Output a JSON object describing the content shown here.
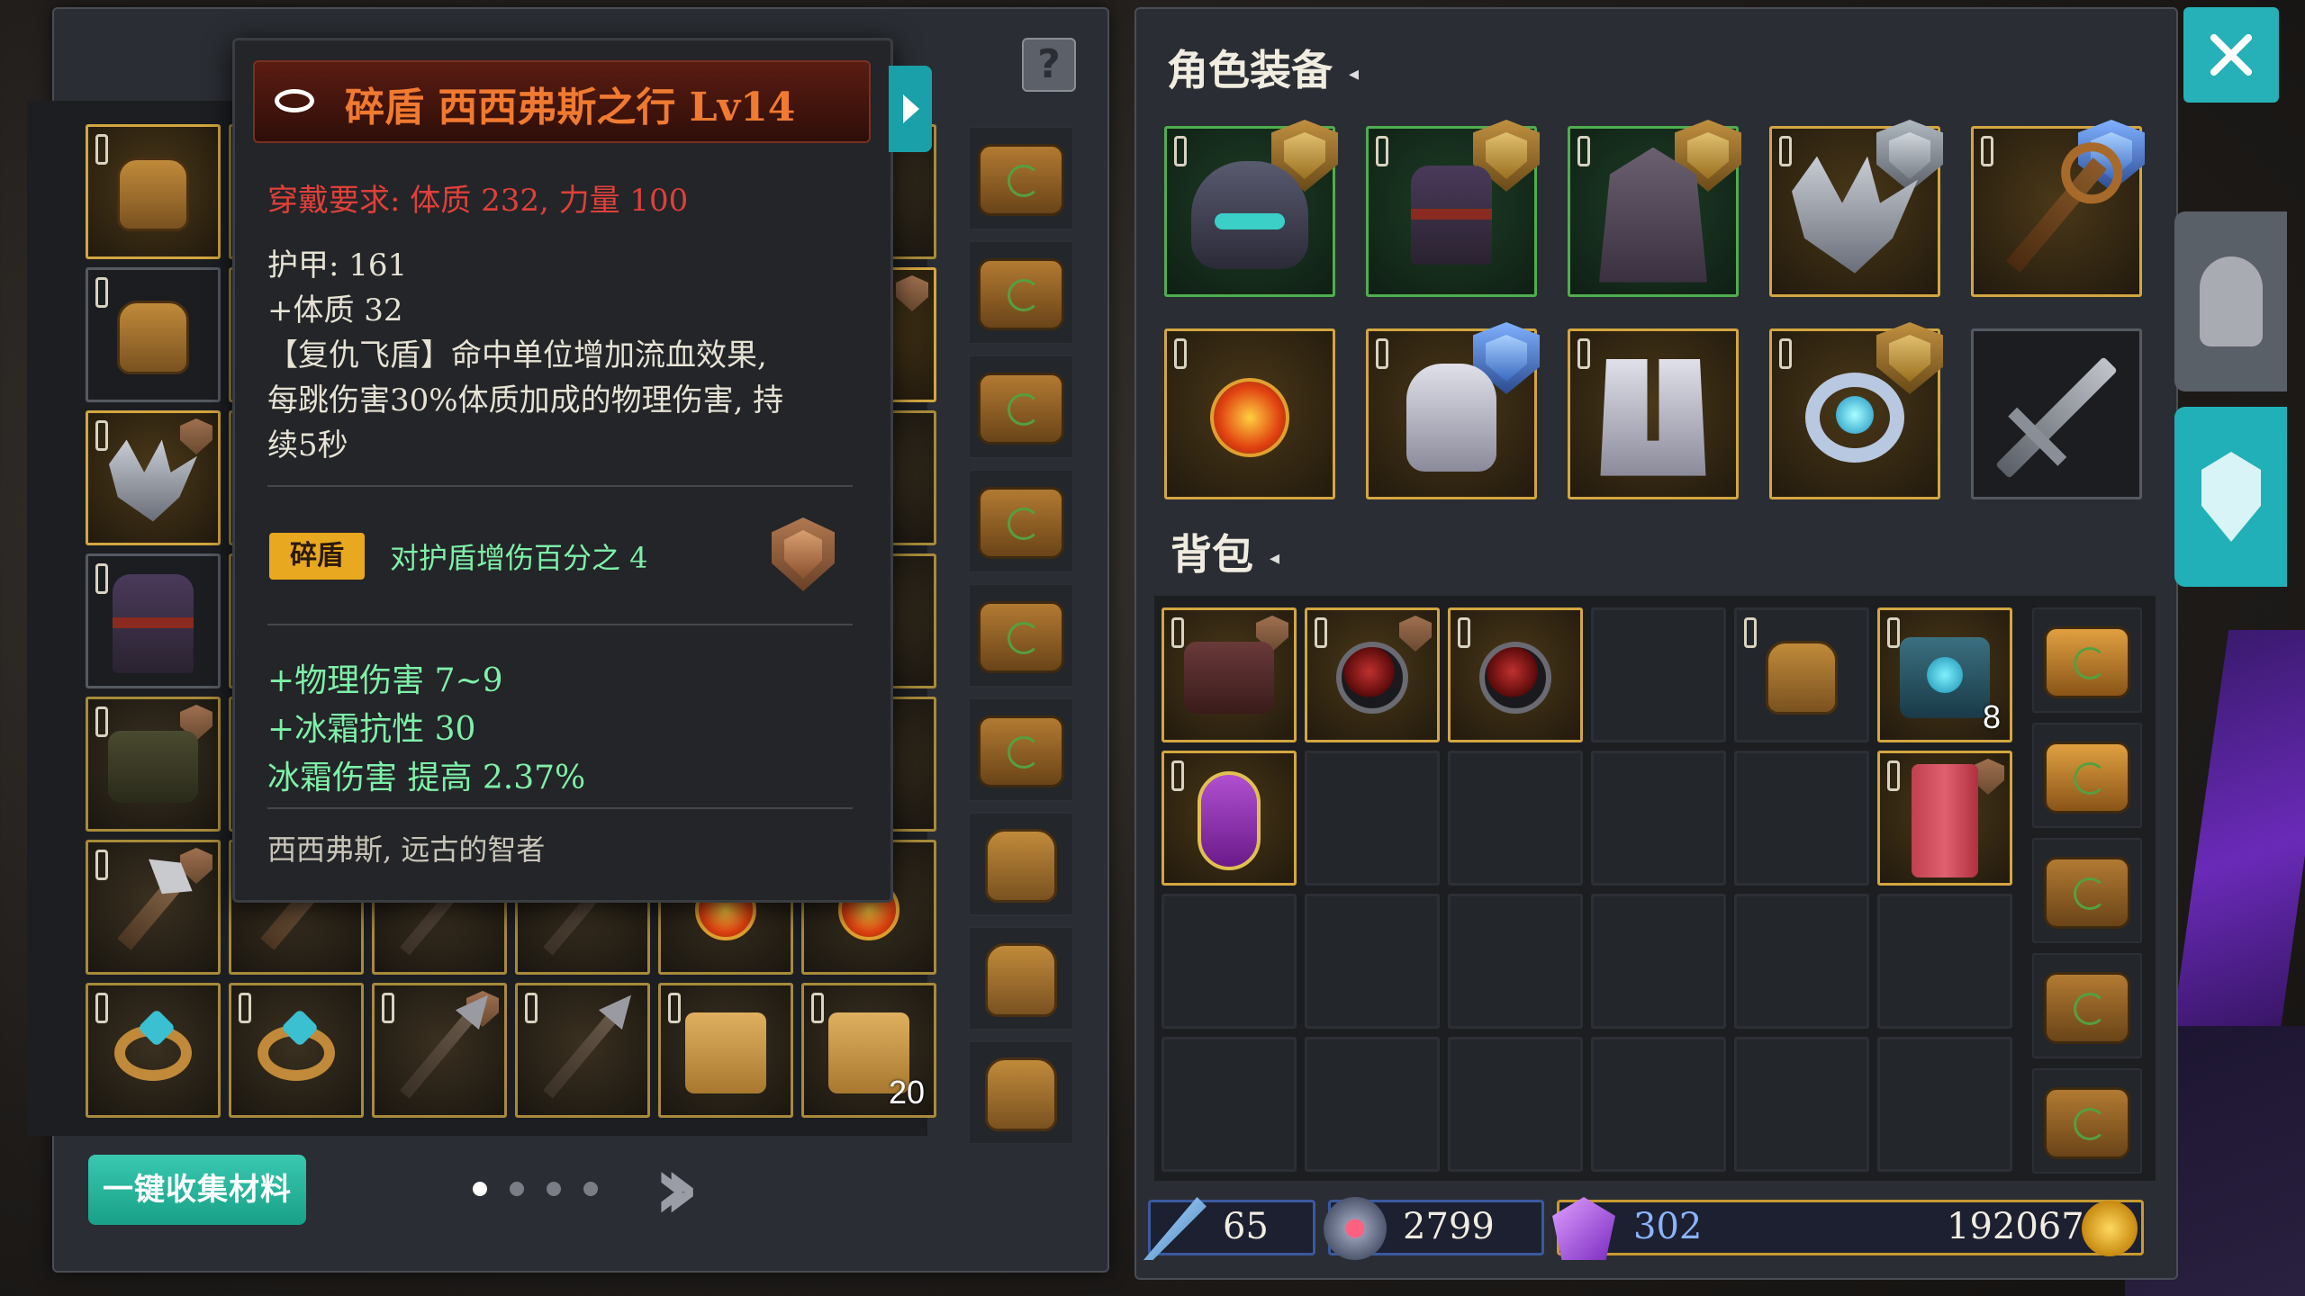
{
  "tooltip": {
    "title": "碎盾  西西弗斯之行  Lv14",
    "requirement": "穿戴要求:  体质 232, 力量 100",
    "armor": "护甲:  161",
    "constitution": "+体质  32",
    "skill_line1": "【复仇飞盾】命中单位增加流血效果,",
    "skill_line2": "每跳伤害30%体质加成的物理伤害, 持",
    "skill_line3": "续5秒",
    "set_tag": "碎盾",
    "set_desc": "对护盾增伤百分之 4",
    "stat1": "+物理伤害  7~9",
    "stat2": "+冰霜抗性  30",
    "stat3": "冰霜伤害  提高  2.37%",
    "lore": "西西弗斯, 远古的智者"
  },
  "left": {
    "collect_button": "一键收集材料",
    "page_count": 4,
    "active_page": 1,
    "stack_count_scroll": "20"
  },
  "right": {
    "equipment_title": "角色装备",
    "bag_title": "背包",
    "bag_stack_count": "8"
  },
  "currency": {
    "wand_value": "65",
    "heart_value": "2799",
    "gem_value": "302",
    "gold_value": "192067"
  },
  "icons": [
    "help-icon",
    "close-icon",
    "helmet-tab-icon",
    "shield-tab-icon",
    "next-page-icon"
  ]
}
